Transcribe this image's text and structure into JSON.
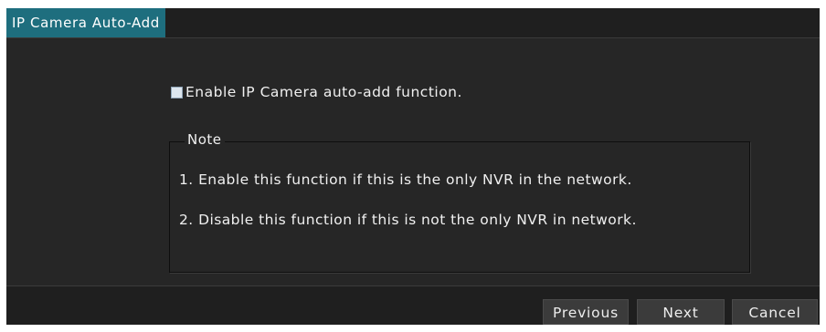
{
  "window": {
    "title": "IP Camera Auto-Add"
  },
  "enable": {
    "checked": false,
    "label": "Enable IP Camera auto-add function."
  },
  "note": {
    "legend": "Note",
    "lines": [
      "1. Enable this function if this is the only NVR in the network.",
      "2. Disable this function if this is not the only NVR in network."
    ]
  },
  "buttons": {
    "previous": "Previous",
    "next": "Next",
    "cancel": "Cancel"
  },
  "colors": {
    "title_accent": "#1e6e7e",
    "background": "#262626",
    "bar": "#1f1f1f"
  }
}
